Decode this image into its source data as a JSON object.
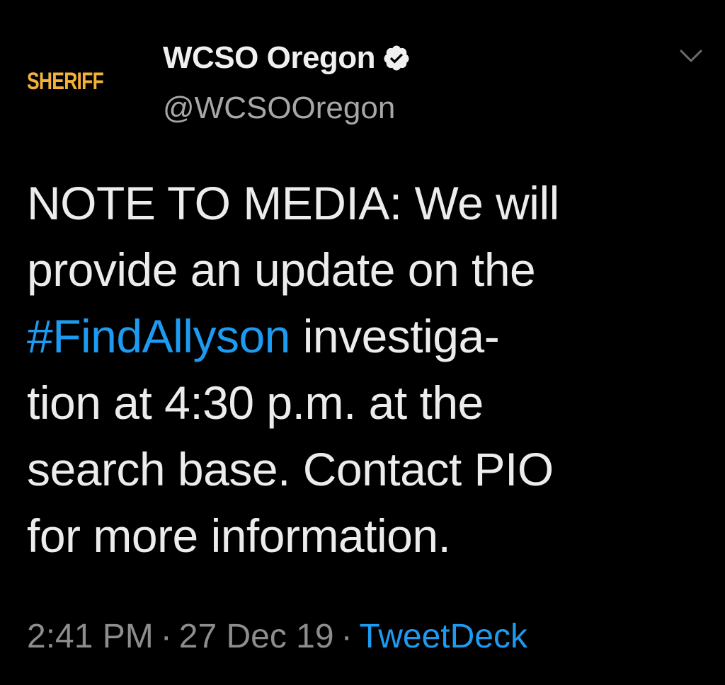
{
  "account": {
    "avatar_text": "SHERIFF",
    "display_name": "WCSO Oregon",
    "handle": "@WCSOOregon",
    "verified_icon": "verified-badge-icon"
  },
  "tweet": {
    "lines": [
      "NOTE TO MEDIA: We will",
      "provide an update on the",
      "investiga-",
      "tion at 4:30 p.m. at the",
      "search base. Contact PIO",
      "for more information."
    ],
    "hashtag": "#FindAllyson"
  },
  "meta": {
    "time": "2:41 PM",
    "date": "27 Dec 19",
    "separator": "·",
    "source": "TweetDeck"
  },
  "colors": {
    "background": "#000000",
    "text": "#ececec",
    "muted": "#8d8d8d",
    "link": "#1d9bf0",
    "avatar_text": "#f2b13a"
  },
  "icons": {
    "menu": "chevron-down-icon"
  }
}
